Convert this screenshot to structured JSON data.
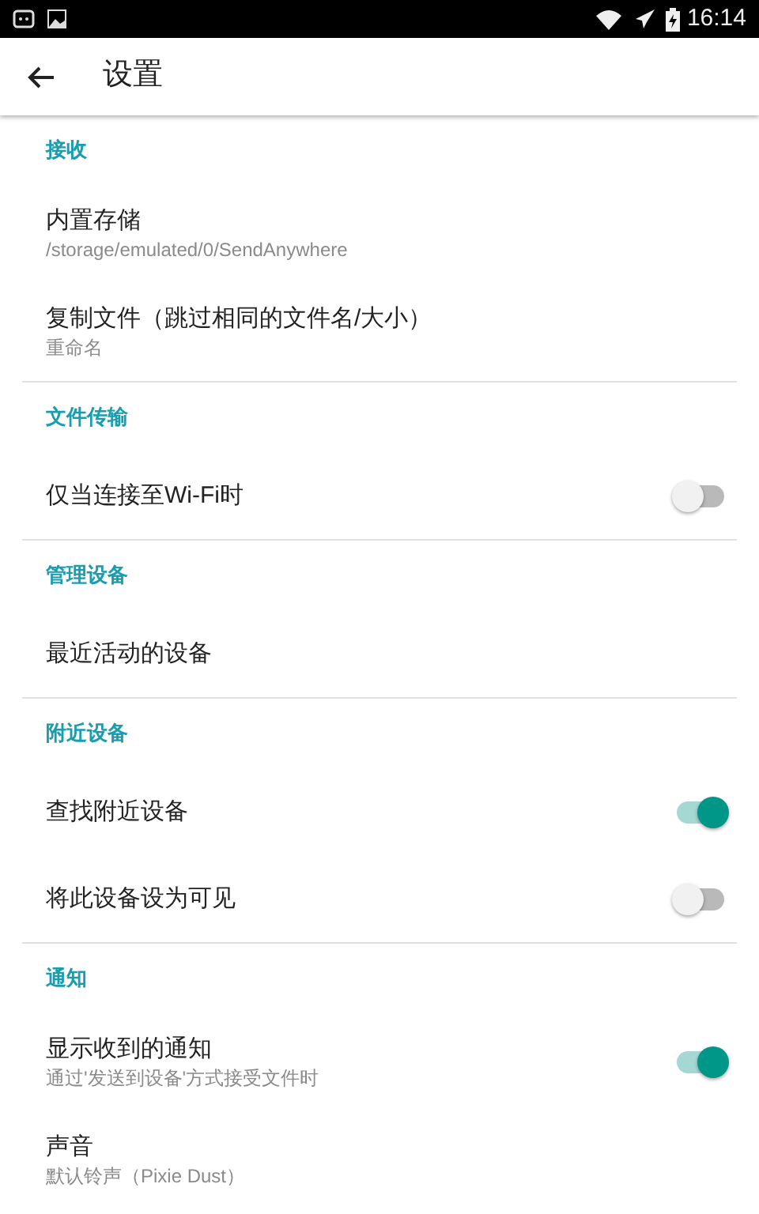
{
  "status_bar": {
    "time": "16:14"
  },
  "app_bar": {
    "title": "设置"
  },
  "sections": [
    {
      "header": "接收",
      "items": [
        {
          "kind": "plain",
          "title": "内置存储",
          "subtitle": "/storage/emulated/0/SendAnywhere"
        },
        {
          "kind": "plain",
          "title": "复制文件（跳过相同的文件名/大小）",
          "subtitle": "重命名"
        }
      ]
    },
    {
      "header": "文件传输",
      "items": [
        {
          "kind": "switch",
          "title": "仅当连接至Wi-Fi时",
          "on": false
        }
      ]
    },
    {
      "header": "管理设备",
      "items": [
        {
          "kind": "plain",
          "title": "最近活动的设备"
        }
      ]
    },
    {
      "header": "附近设备",
      "items": [
        {
          "kind": "switch",
          "title": "查找附近设备",
          "on": true
        },
        {
          "kind": "switch",
          "title": "将此设备设为可见",
          "on": false
        }
      ]
    },
    {
      "header": "通知",
      "items": [
        {
          "kind": "switch",
          "title": "显示收到的通知",
          "subtitle": "通过'发送到设备'方式接受文件时",
          "on": true
        },
        {
          "kind": "plain",
          "title": "声音",
          "subtitle": "默认铃声（Pixie Dust）"
        }
      ]
    }
  ]
}
